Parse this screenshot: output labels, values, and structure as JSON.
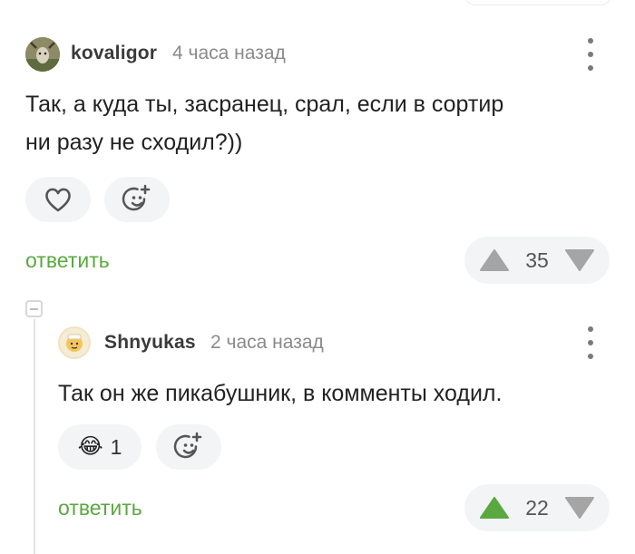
{
  "comment1": {
    "username": "kovaligor",
    "time": "4 часа назад",
    "text_line1": "Так, а куда ты, засранец, срал, если в сортир",
    "text_line2": "ни разу не сходил?))",
    "reply_label": "ответить",
    "rating": "35",
    "vote": "none"
  },
  "comment2": {
    "username": "Shnyukas",
    "time": "2 часа назад",
    "text": "Так он же пикабушник, в комменты ходил.",
    "reaction_emoji": "😂",
    "reaction_count": "1",
    "reply_label": "ответить",
    "rating": "22",
    "vote": "up"
  },
  "icons": {
    "heart": "heart-icon",
    "add_reaction": "add-emoji-icon",
    "menu": "kebab-menu-icon",
    "vote_up": "triangle-up-icon",
    "vote_down": "triangle-down-icon",
    "collapse": "collapse-thread-icon"
  },
  "colors": {
    "accent_green": "#59a940",
    "vote_gray": "#a5a5a5",
    "vote_up_active": "#59a940",
    "pill_bg": "#f3f4f6"
  }
}
